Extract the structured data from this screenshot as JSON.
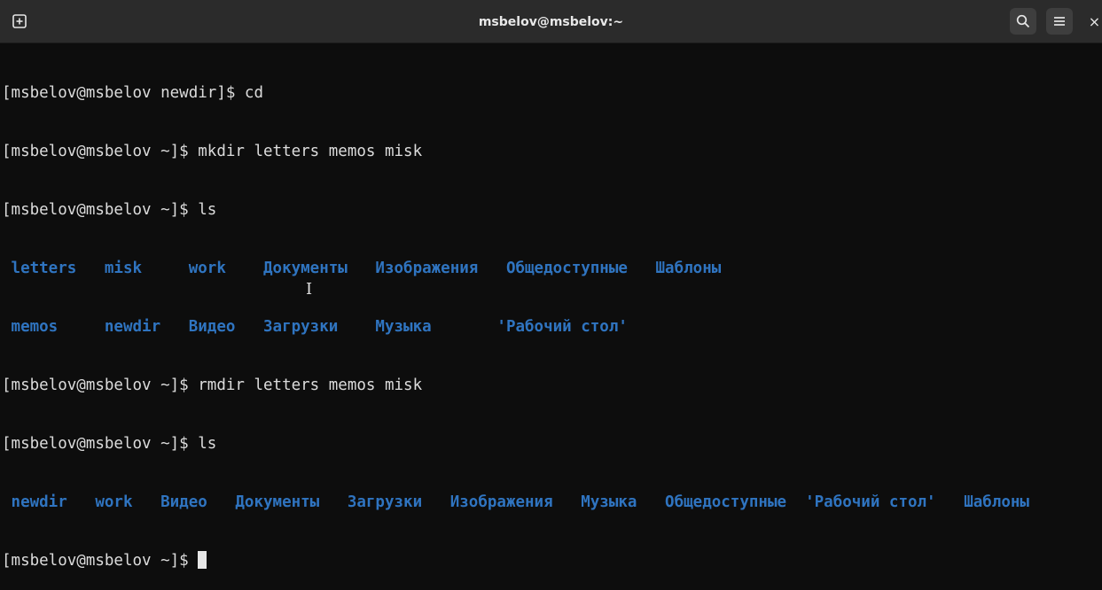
{
  "window": {
    "title": "msbelov@msbelov:~",
    "close_glyph": "×"
  },
  "terminal": {
    "line1": "[msbelov@msbelov newdir]$ cd",
    "line2": "[msbelov@msbelov ~]$ mkdir letters memos misk",
    "line3": "[msbelov@msbelov ~]$ ls",
    "ls1_row1": " letters   misk     work    Документы   Изображения   Общедоступные   Шаблоны",
    "ls1_row2": " memos     newdir   Видео   Загрузки    Музыка       'Рабочий стол'",
    "line6": "[msbelov@msbelov ~]$ rmdir letters memos misk",
    "line7": "[msbelov@msbelov ~]$ ls",
    "ls2_row1": " newdir   work   Видео   Документы   Загрузки   Изображения   Музыка   Общедоступные  'Рабочий стол'   Шаблоны",
    "prompt": "[msbelov@msbelov ~]$ "
  },
  "icons": {
    "new_tab": "new-tab-icon",
    "search": "search-icon",
    "menu": "hamburger-menu-icon",
    "close": "close-icon",
    "cursor": "text-cursor-icon"
  },
  "colors": {
    "background": "#0d0d0d",
    "titlebar": "#2b2b2b",
    "text": "#dcdcdc",
    "directory": "#2f74c0"
  }
}
